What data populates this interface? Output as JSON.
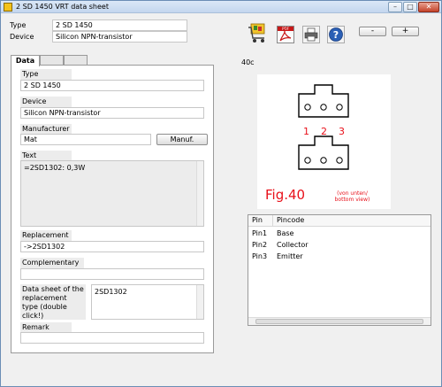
{
  "window": {
    "title": "2 SD 1450 VRT data sheet",
    "btn_min": "–",
    "btn_max": "□",
    "btn_close": "✕"
  },
  "header": {
    "type_label": "Type",
    "type_value": "2 SD 1450",
    "device_label": "Device",
    "device_value": "Silicon NPN-transistor"
  },
  "toolbar": {
    "zoom_out": "-",
    "zoom_in": "+",
    "fig_code": "40c"
  },
  "tabs": [
    "Data",
    "",
    ""
  ],
  "data": {
    "type_label": "Type",
    "type_value": "2 SD 1450",
    "device_label": "Device",
    "device_value": "Silicon NPN-transistor",
    "manufacturer_label": "Manufacturer",
    "manufacturer_value": "Mat",
    "manuf_button": "Manuf.",
    "text_label": "Text",
    "text_value": "=2SD1302: 0,3W",
    "replacement_label": "Replacement",
    "replacement_value": "->2SD1302",
    "complementary_label": "Complementary",
    "complementary_value": "",
    "datasheet_label": "Data sheet of the replacement type (double click!)",
    "datasheet_value": "2SD1302",
    "remark_label": "Remark",
    "remark_value": ""
  },
  "figure": {
    "pins": [
      "1",
      "2",
      "3"
    ],
    "caption": "Fig.40",
    "view_note": "(von unten/ bottom view)"
  },
  "pin_table": {
    "headers": [
      "Pin",
      "Pincode"
    ],
    "rows": [
      [
        "Pin1",
        "Base"
      ],
      [
        "Pin2",
        "Collector"
      ],
      [
        "Pin3",
        "Emitter"
      ]
    ]
  },
  "colors": {
    "figure_red": "#e8101a",
    "accent": "#3468b8"
  }
}
